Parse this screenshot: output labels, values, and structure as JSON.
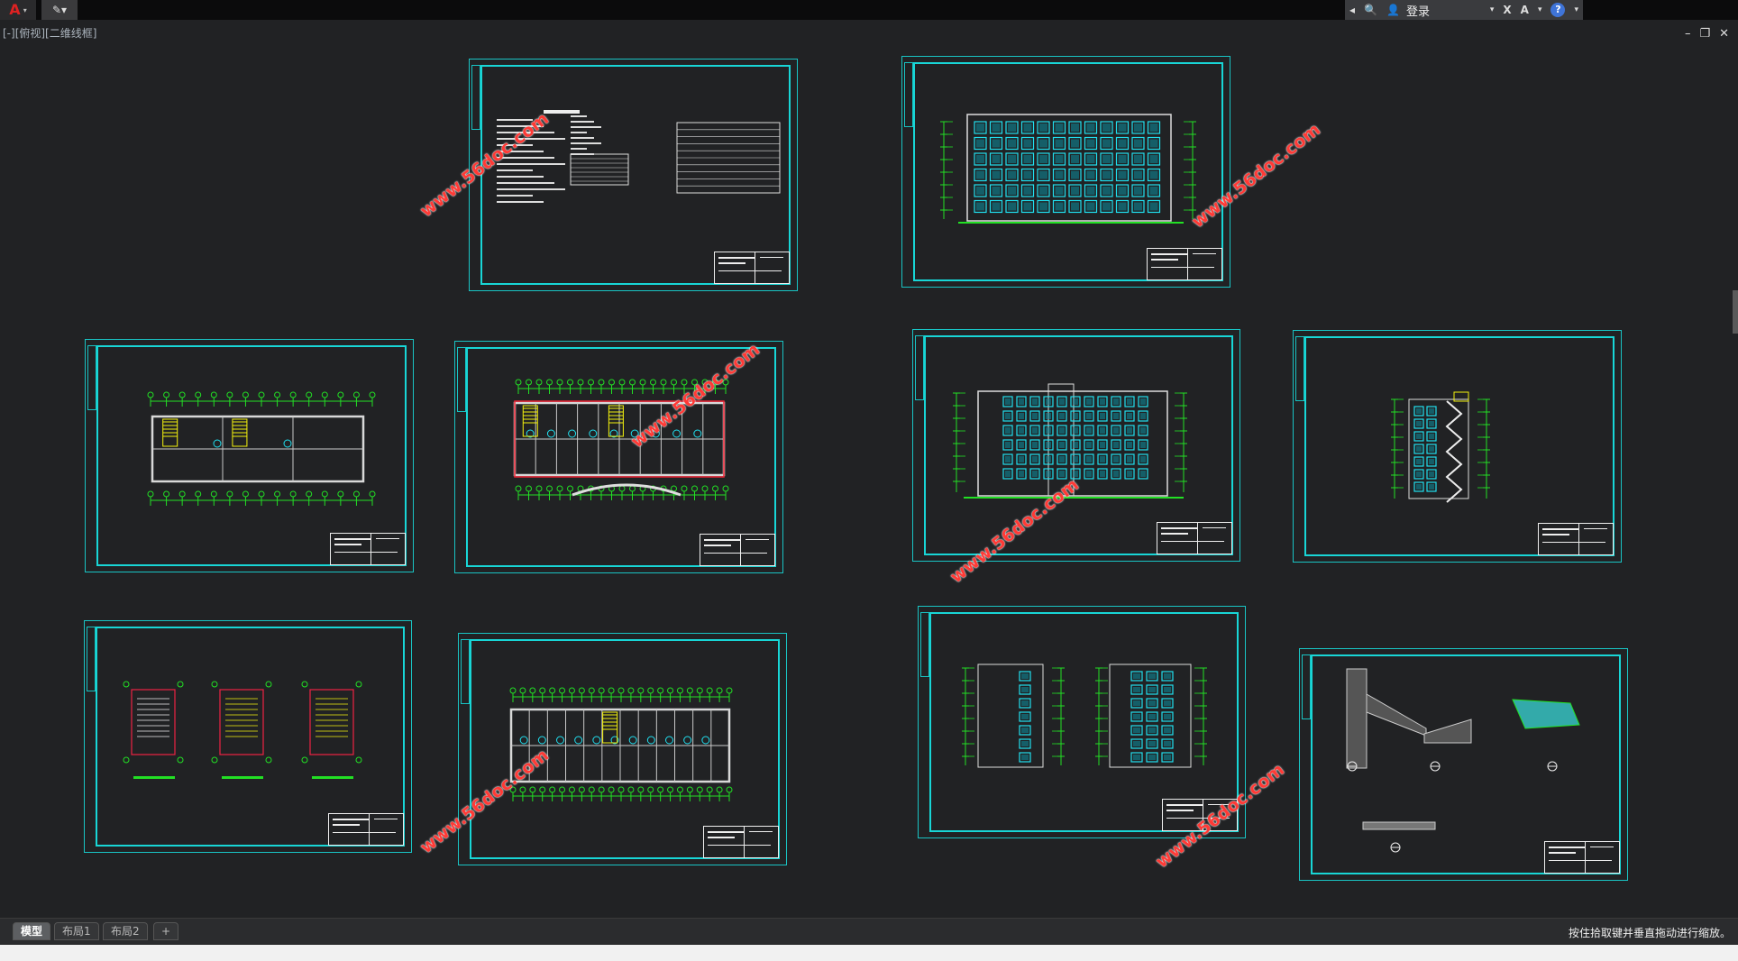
{
  "topbar": {
    "app_logo": "A",
    "caret": "▾",
    "quick_access": "✎▾",
    "search": {
      "arrow": "◂",
      "binoculars": "🔍",
      "user": "👤",
      "login_label": "登录",
      "dropdown": "▾",
      "exchange": "X",
      "autodesk": "A",
      "help": "?"
    }
  },
  "viewport": {
    "view_label": "[-][俯视][二维线框]",
    "window_controls": [
      "–",
      "❐",
      "✕"
    ]
  },
  "watermark_text": "www.56doc.com",
  "tabs": [
    {
      "label": "模型",
      "active": true
    },
    {
      "label": "布局1",
      "active": false
    },
    {
      "label": "布局2",
      "active": false
    },
    {
      "label": "+",
      "active": false
    }
  ],
  "status": {
    "message": "按住拾取键并垂直拖动进行缩放。"
  },
  "colors": {
    "background": "#212224",
    "sheet_border": "#18d6d6",
    "drawing_green": "#22e024",
    "window_cyan": "#20e0f0",
    "highlight_yellow": "#f4f20e",
    "watermark_red": "#ff3a36"
  }
}
